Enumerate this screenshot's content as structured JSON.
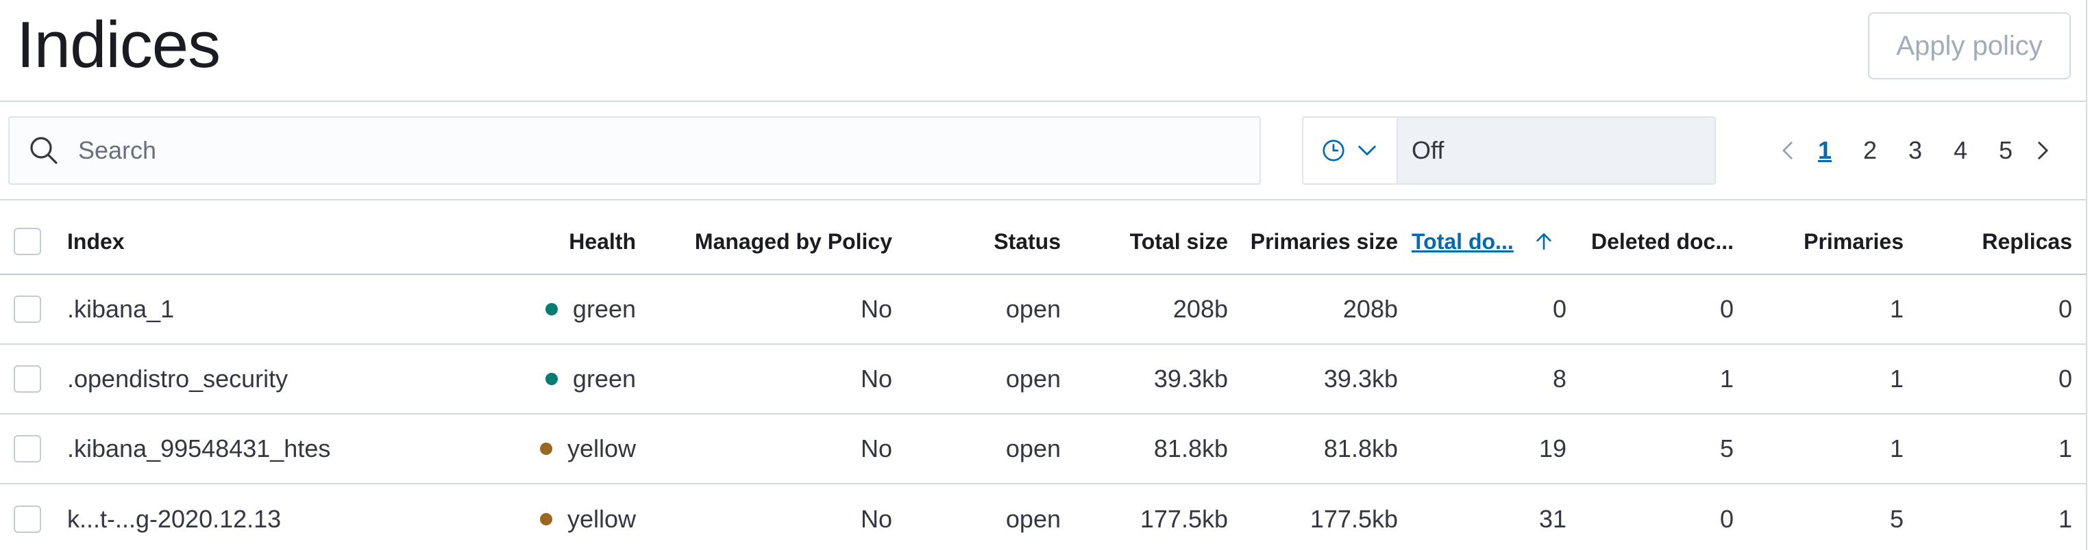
{
  "page": {
    "title": "Indices",
    "apply_policy_label": "Apply policy"
  },
  "search": {
    "placeholder": "Search"
  },
  "refresh": {
    "value": "Off"
  },
  "pagination": {
    "pages": [
      "1",
      "2",
      "3",
      "4",
      "5"
    ],
    "current": "1"
  },
  "table": {
    "columns": {
      "index": "Index",
      "health": "Health",
      "managed": "Managed by Policy",
      "status": "Status",
      "total_size": "Total size",
      "primaries_size": "Primaries size",
      "total_docs": "Total do...",
      "deleted_docs": "Deleted doc...",
      "primaries": "Primaries",
      "replicas": "Replicas"
    },
    "rows": [
      {
        "index": ".kibana_1",
        "health": "green",
        "managed": "No",
        "status": "open",
        "total_size": "208b",
        "primaries_size": "208b",
        "total_docs": "0",
        "deleted_docs": "0",
        "primaries": "1",
        "replicas": "0"
      },
      {
        "index": ".opendistro_security",
        "health": "green",
        "managed": "No",
        "status": "open",
        "total_size": "39.3kb",
        "primaries_size": "39.3kb",
        "total_docs": "8",
        "deleted_docs": "1",
        "primaries": "1",
        "replicas": "0"
      },
      {
        "index": ".kibana_99548431_htes",
        "health": "yellow",
        "managed": "No",
        "status": "open",
        "total_size": "81.8kb",
        "primaries_size": "81.8kb",
        "total_docs": "19",
        "deleted_docs": "5",
        "primaries": "1",
        "replicas": "1"
      },
      {
        "index": "k...t-...g-2020.12.13",
        "health": "yellow",
        "managed": "No",
        "status": "open",
        "total_size": "177.5kb",
        "primaries_size": "177.5kb",
        "total_docs": "31",
        "deleted_docs": "0",
        "primaries": "5",
        "replicas": "1"
      }
    ]
  },
  "colors": {
    "green": "#017d73",
    "yellow": "#9a6620",
    "accent": "#006bb4"
  }
}
